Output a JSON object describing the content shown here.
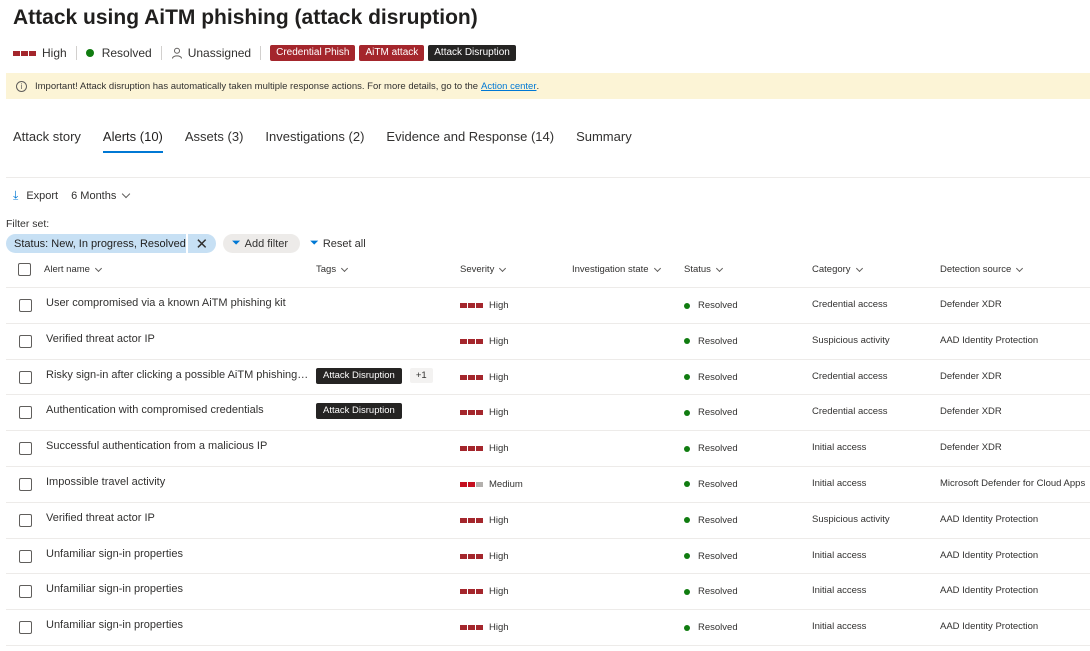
{
  "page": {
    "title": "Attack using AiTM phishing (attack disruption)"
  },
  "meta": {
    "severity": "High",
    "status": "Resolved",
    "assignee": "Unassigned",
    "tags": [
      "Credential Phish",
      "AiTM attack",
      "Attack Disruption"
    ]
  },
  "banner": {
    "text": "Important! Attack disruption has automatically taken multiple response actions. For more details, go to the",
    "link": "Action center",
    "end": "."
  },
  "tabs": [
    "Attack story",
    "Alerts (10)",
    "Assets (3)",
    "Investigations (2)",
    "Evidence and Response (14)",
    "Summary"
  ],
  "active_tab": "Alerts (10)",
  "toolbar": {
    "export_label": "Export",
    "period_label": "6 Months"
  },
  "filters": {
    "label": "Filter set:",
    "active_filter": "Status: New, In progress, Resolved",
    "add_label": "Add filter",
    "reset_label": "Reset all"
  },
  "table": {
    "columns": [
      "Alert name",
      "Tags",
      "Severity",
      "Investigation state",
      "Status",
      "Category",
      "Detection source"
    ],
    "rows": [
      {
        "name": "User compromised via a known AiTM phishing kit",
        "tag": "",
        "extra": "",
        "severity": "High",
        "level": 3,
        "status": "Resolved",
        "category": "Credential access",
        "source": "Defender XDR"
      },
      {
        "name": "Verified threat actor IP",
        "tag": "",
        "extra": "",
        "severity": "High",
        "level": 3,
        "status": "Resolved",
        "category": "Suspicious activity",
        "source": "AAD Identity Protection"
      },
      {
        "name": "Risky sign-in after clicking a possible AiTM phishing URL",
        "tag": "Attack Disruption",
        "extra": "+1",
        "severity": "High",
        "level": 3,
        "status": "Resolved",
        "category": "Credential access",
        "source": "Defender XDR"
      },
      {
        "name": "Authentication with compromised credentials",
        "tag": "Attack Disruption",
        "extra": "",
        "severity": "High",
        "level": 3,
        "status": "Resolved",
        "category": "Credential access",
        "source": "Defender XDR"
      },
      {
        "name": "Successful authentication from a malicious IP",
        "tag": "",
        "extra": "",
        "severity": "High",
        "level": 3,
        "status": "Resolved",
        "category": "Initial access",
        "source": "Defender XDR"
      },
      {
        "name": "Impossible travel activity",
        "tag": "",
        "extra": "",
        "severity": "Medium",
        "level": 2,
        "status": "Resolved",
        "category": "Initial access",
        "source": "Microsoft Defender for Cloud Apps"
      },
      {
        "name": "Verified threat actor IP",
        "tag": "",
        "extra": "",
        "severity": "High",
        "level": 3,
        "status": "Resolved",
        "category": "Suspicious activity",
        "source": "AAD Identity Protection"
      },
      {
        "name": "Unfamiliar sign-in properties",
        "tag": "",
        "extra": "",
        "severity": "High",
        "level": 3,
        "status": "Resolved",
        "category": "Initial access",
        "source": "AAD Identity Protection"
      },
      {
        "name": "Unfamiliar sign-in properties",
        "tag": "",
        "extra": "",
        "severity": "High",
        "level": 3,
        "status": "Resolved",
        "category": "Initial access",
        "source": "AAD Identity Protection"
      },
      {
        "name": "Unfamiliar sign-in properties",
        "tag": "",
        "extra": "",
        "severity": "High",
        "level": 3,
        "status": "Resolved",
        "category": "Initial access",
        "source": "AAD Identity Protection"
      }
    ]
  },
  "colors": {
    "accent": "#0078d4",
    "severity_high": "#a4262c",
    "severity_medium": "#c50f1f",
    "resolved": "#107c10",
    "banner_bg": "#fcf4d6"
  }
}
